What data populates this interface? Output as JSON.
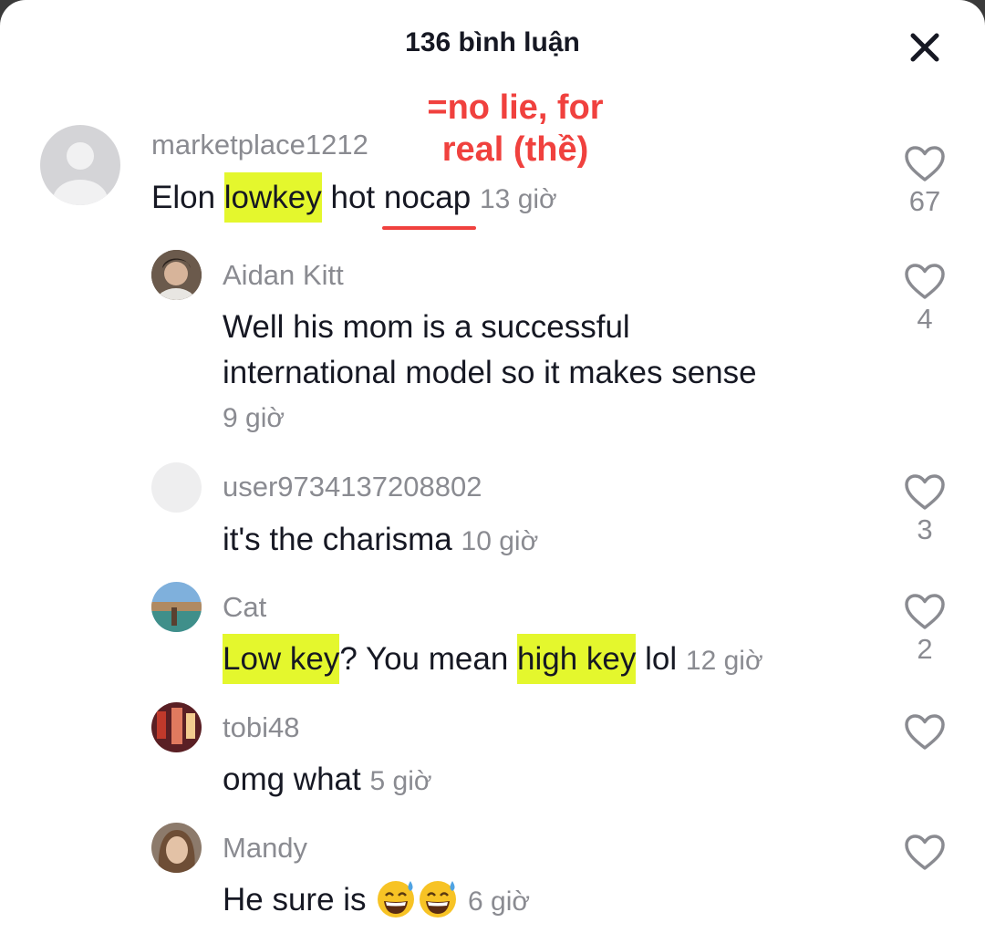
{
  "header": {
    "title": "136 bình luận"
  },
  "annotation": {
    "line1": "=no lie, for",
    "line2": "real (thề)"
  },
  "comments": [
    {
      "username": "marketplace1212",
      "text_parts": [
        "Elon ",
        "lowkey",
        " hot ",
        "nocap"
      ],
      "time": "13 giờ",
      "likes": "67"
    },
    {
      "username": "Aidan Kitt",
      "text_line1": "Well his mom is a successful",
      "text_line2": "international model so it makes sense",
      "time": "9 giờ",
      "likes": "4"
    },
    {
      "username": "user9734137208802",
      "text": "it's the charisma",
      "time": "10 giờ",
      "likes": "3"
    },
    {
      "username": "Cat",
      "text_parts": [
        "Low key",
        "? You mean ",
        "high key",
        " lol"
      ],
      "time": "12 giờ",
      "likes": "2"
    },
    {
      "username": "tobi48",
      "text": "omg what",
      "time": "5 giờ",
      "likes": ""
    },
    {
      "username": "Mandy",
      "text": "He sure is",
      "emojis": [
        "grinning-sweat-emoji",
        "grinning-sweat-emoji"
      ],
      "time": "6 giờ",
      "likes": ""
    }
  ],
  "colors": {
    "highlight": "#e4f72d",
    "annotation": "#f0413e",
    "text": "#161823",
    "muted": "#8a8b91"
  },
  "icons": [
    "close-icon",
    "heart-outline-icon",
    "default-avatar-icon"
  ]
}
